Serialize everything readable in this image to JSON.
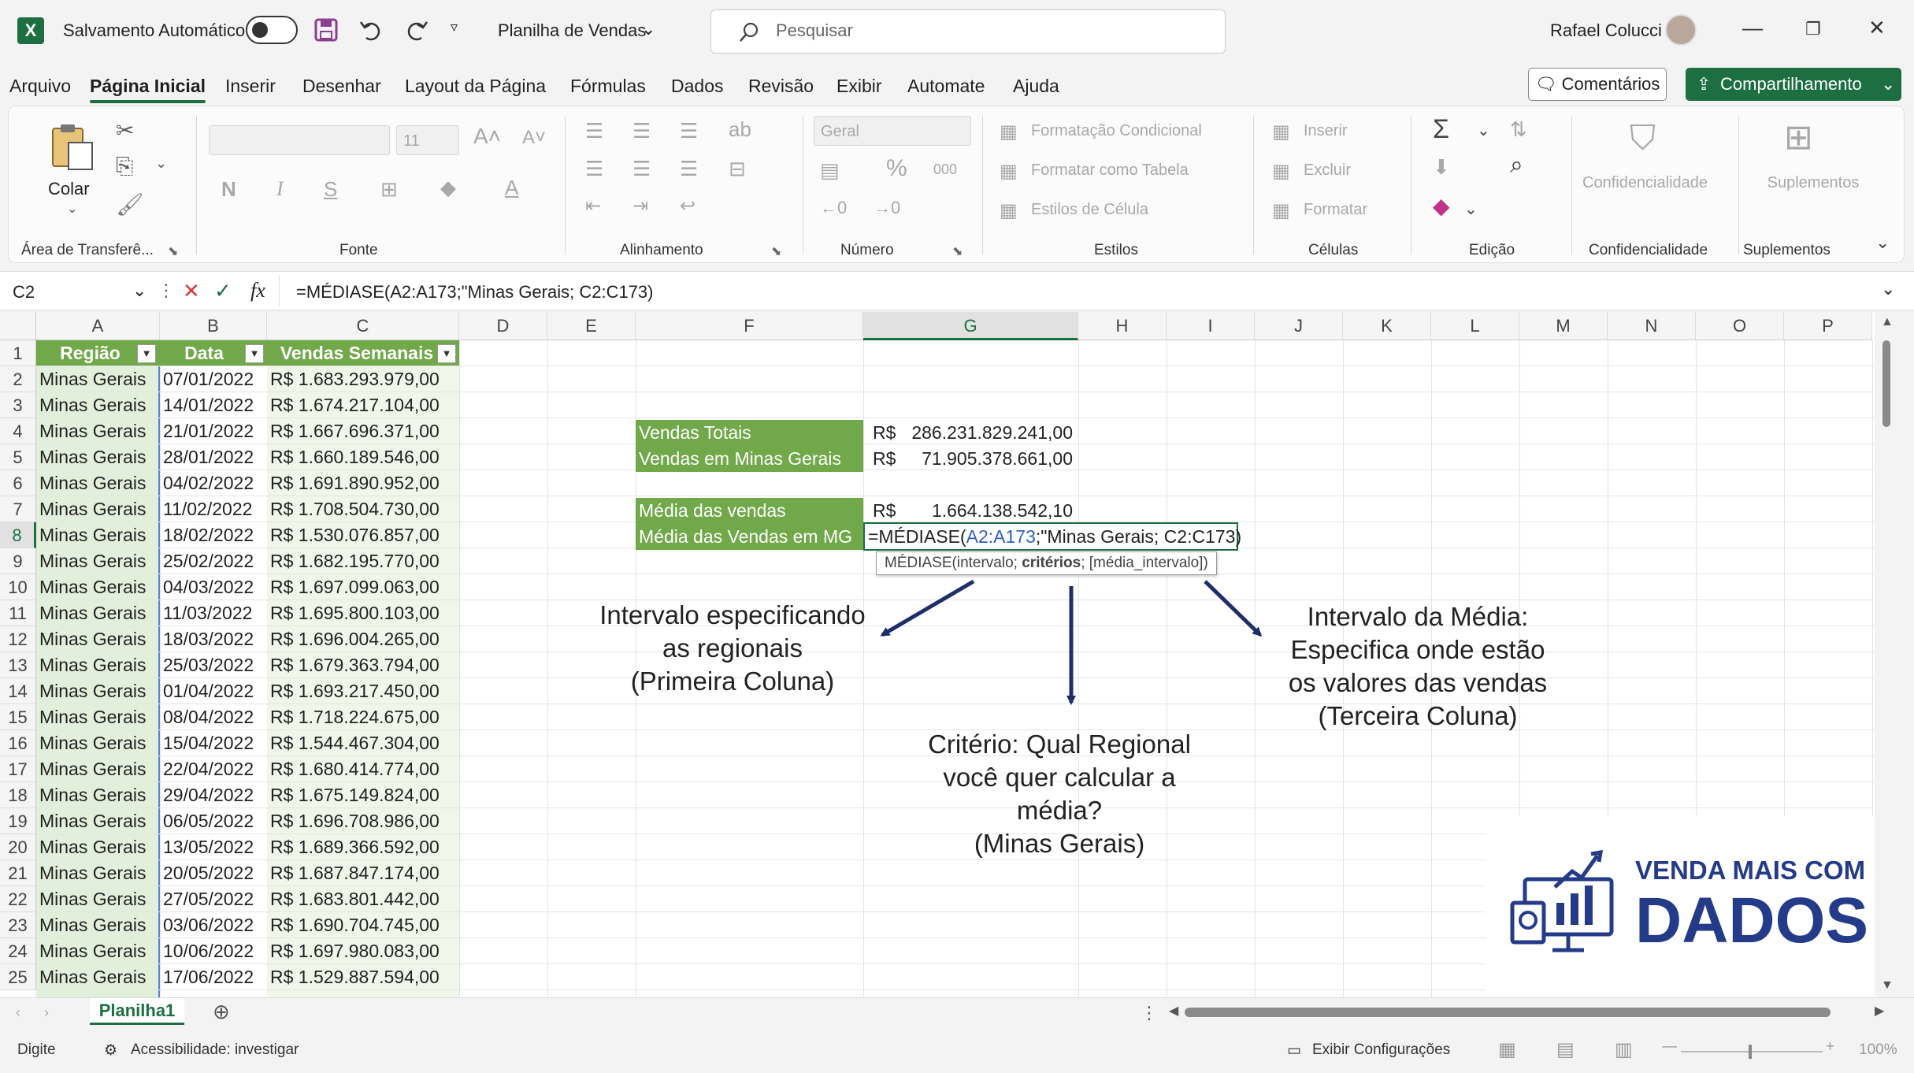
{
  "titlebar": {
    "app_logo": "X",
    "autosave_label": "Salvamento Automático",
    "doc_title": "Planilha de Vendas",
    "search_placeholder": "Pesquisar",
    "user_name": "Rafael Colucci"
  },
  "menu": {
    "tabs": [
      "Arquivo",
      "Página Inicial",
      "Inserir",
      "Desenhar",
      "Layout da Página",
      "Fórmulas",
      "Dados",
      "Revisão",
      "Exibir",
      "Automate",
      "Ajuda"
    ],
    "active_tab": "Página Inicial",
    "comments_label": "Comentários",
    "share_label": "Compartilhamento"
  },
  "ribbon": {
    "paste_label": "Colar",
    "groups": {
      "clipboard": "Área de Transferê...",
      "font": "Fonte",
      "alignment": "Alinhamento",
      "number": "Número",
      "styles": "Estilos",
      "cells": "Células",
      "editing": "Edição",
      "sensitivity": "Confidencialidade",
      "addins": "Suplementos"
    },
    "font_size": "11",
    "number_format": "Geral",
    "bold": "N",
    "italic": "I",
    "underline": "S",
    "percent": "%",
    "thousands": "000",
    "styles_items": [
      "Formatação Condicional",
      "Formatar como Tabela",
      "Estilos de Célula"
    ],
    "cells_items": [
      "Inserir",
      "Excluir",
      "Formatar"
    ],
    "sensitivity_btn": "Confidencialidade",
    "addins_btn": "Suplementos"
  },
  "formula_bar": {
    "name_box": "C2",
    "fx": "fx",
    "formula": "=MÉDIASE(A2:A173;\"Minas Gerais; C2:C173)"
  },
  "grid": {
    "columns": [
      "A",
      "B",
      "C",
      "D",
      "E",
      "F",
      "G",
      "H",
      "I",
      "J",
      "K",
      "L",
      "M",
      "N",
      "O",
      "P"
    ],
    "table_headers": [
      "Região",
      "Data",
      "Vendas Semanais"
    ],
    "rows": [
      {
        "n": "2",
        "regiao": "Minas Gerais",
        "data": "07/01/2022",
        "vendas": "R$ 1.683.293.979,00"
      },
      {
        "n": "3",
        "regiao": "Minas Gerais",
        "data": "14/01/2022",
        "vendas": "R$ 1.674.217.104,00"
      },
      {
        "n": "4",
        "regiao": "Minas Gerais",
        "data": "21/01/2022",
        "vendas": "R$ 1.667.696.371,00"
      },
      {
        "n": "5",
        "regiao": "Minas Gerais",
        "data": "28/01/2022",
        "vendas": "R$ 1.660.189.546,00"
      },
      {
        "n": "6",
        "regiao": "Minas Gerais",
        "data": "04/02/2022",
        "vendas": "R$ 1.691.890.952,00"
      },
      {
        "n": "7",
        "regiao": "Minas Gerais",
        "data": "11/02/2022",
        "vendas": "R$ 1.708.504.730,00"
      },
      {
        "n": "8",
        "regiao": "Minas Gerais",
        "data": "18/02/2022",
        "vendas": "R$ 1.530.076.857,00"
      },
      {
        "n": "9",
        "regiao": "Minas Gerais",
        "data": "25/02/2022",
        "vendas": "R$ 1.682.195.770,00"
      },
      {
        "n": "10",
        "regiao": "Minas Gerais",
        "data": "04/03/2022",
        "vendas": "R$ 1.697.099.063,00"
      },
      {
        "n": "11",
        "regiao": "Minas Gerais",
        "data": "11/03/2022",
        "vendas": "R$ 1.695.800.103,00"
      },
      {
        "n": "12",
        "regiao": "Minas Gerais",
        "data": "18/03/2022",
        "vendas": "R$ 1.696.004.265,00"
      },
      {
        "n": "13",
        "regiao": "Minas Gerais",
        "data": "25/03/2022",
        "vendas": "R$ 1.679.363.794,00"
      },
      {
        "n": "14",
        "regiao": "Minas Gerais",
        "data": "01/04/2022",
        "vendas": "R$ 1.693.217.450,00"
      },
      {
        "n": "15",
        "regiao": "Minas Gerais",
        "data": "08/04/2022",
        "vendas": "R$ 1.718.224.675,00"
      },
      {
        "n": "16",
        "regiao": "Minas Gerais",
        "data": "15/04/2022",
        "vendas": "R$ 1.544.467.304,00"
      },
      {
        "n": "17",
        "regiao": "Minas Gerais",
        "data": "22/04/2022",
        "vendas": "R$ 1.680.414.774,00"
      },
      {
        "n": "18",
        "regiao": "Minas Gerais",
        "data": "29/04/2022",
        "vendas": "R$ 1.675.149.824,00"
      },
      {
        "n": "19",
        "regiao": "Minas Gerais",
        "data": "06/05/2022",
        "vendas": "R$ 1.696.708.986,00"
      },
      {
        "n": "20",
        "regiao": "Minas Gerais",
        "data": "13/05/2022",
        "vendas": "R$ 1.689.366.592,00"
      },
      {
        "n": "21",
        "regiao": "Minas Gerais",
        "data": "20/05/2022",
        "vendas": "R$ 1.687.847.174,00"
      },
      {
        "n": "22",
        "regiao": "Minas Gerais",
        "data": "27/05/2022",
        "vendas": "R$ 1.683.801.442,00"
      },
      {
        "n": "23",
        "regiao": "Minas Gerais",
        "data": "03/06/2022",
        "vendas": "R$ 1.690.704.745,00"
      },
      {
        "n": "24",
        "regiao": "Minas Gerais",
        "data": "10/06/2022",
        "vendas": "R$ 1.697.980.083,00"
      },
      {
        "n": "25",
        "regiao": "Minas Gerais",
        "data": "17/06/2022",
        "vendas": "R$ 1.529.887.594,00"
      }
    ],
    "summary": {
      "vendas_totais_label": "Vendas Totais",
      "vendas_totais_cur": "R$",
      "vendas_totais_value": "286.231.829.241,00",
      "vendas_mg_label": "Vendas em Minas Gerais",
      "vendas_mg_cur": "R$",
      "vendas_mg_value": "71.905.378.661,00",
      "media_label": "Média das vendas",
      "media_cur": "R$",
      "media_value": "1.664.138.542,10",
      "media_mg_label": "Média das Vendas em MG"
    },
    "edit_formula": {
      "prefix": "=MÉDIASE(",
      "range": "A2:A173",
      "rest": ";\"Minas Gerais; C2:C173)"
    },
    "tooltip": {
      "fn": "MÉDIASE(intervalo; ",
      "current_arg": "critérios",
      "rest": "; [média_intervalo])"
    }
  },
  "annotations": {
    "intervalo": [
      "Intervalo especificando",
      "as regionais",
      "(Primeira Coluna)"
    ],
    "criterio": [
      "Critério: Qual Regional",
      "você quer calcular a",
      "média?",
      "(Minas Gerais)"
    ],
    "media": [
      "Intervalo da Média:",
      "Especifica onde estão",
      "os valores das vendas",
      "(Terceira Coluna)"
    ]
  },
  "watermark": {
    "line1": "VENDA MAIS COM",
    "line2": "DADOS"
  },
  "sheets": {
    "active": "Planilha1"
  },
  "status": {
    "mode": "Digite",
    "accessibility": "Acessibilidade: investigar",
    "display_settings": "Exibir Configurações",
    "zoom": "100%"
  },
  "colors": {
    "excel_green": "#1d6f42",
    "table_green": "#70a84a",
    "light_green_fill": "#e2efda",
    "arrow_navy": "#1f2d6b",
    "logo_navy": "#243b8a"
  }
}
